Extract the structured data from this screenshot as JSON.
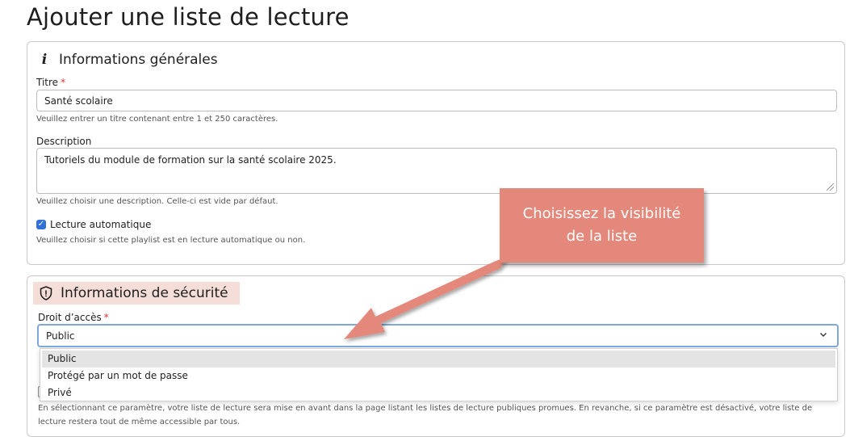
{
  "page": {
    "title": "Ajouter une liste de lecture"
  },
  "general": {
    "section_title": "Informations générales",
    "icon": "info-icon",
    "title_label": "Titre",
    "required_mark": "*",
    "title_value": "Santé scolaire",
    "title_help": "Veuillez entrer un titre contenant entre 1 et 250 caractères.",
    "description_label": "Description",
    "description_value": "Tutoriels du module de formation sur la santé scolaire 2025.",
    "description_help": "Veuillez choisir une description. Celle-ci est vide par défaut.",
    "autoplay_label": "Lecture automatique",
    "autoplay_checked": true,
    "autoplay_help": "Veuillez choisir si cette playlist est en lecture automatique ou non."
  },
  "security": {
    "section_title": "Informations de sécurité",
    "icon": "shield-icon",
    "access_label": "Droit d’accès",
    "required_mark": "*",
    "selected_value": "Public",
    "options": [
      "Public",
      "Protégé par un mot de passe",
      "Privé"
    ],
    "promoted_help_line1": "En sélectionnant ce paramètre, votre liste de lecture sera mise en avant dans la page listant les listes de lecture publiques promues. En revanche, si ce paramètre est désactivé, votre liste de",
    "promoted_help_line2": "lecture restera tout de même accessible par tous."
  },
  "callout": {
    "line1": "Choisissez la visibilité",
    "line2": "de la liste",
    "color": "#e3887a"
  },
  "colors": {
    "accent": "#2f6fda",
    "required": "#d9342b",
    "focus_border": "#7fa9dc",
    "highlight": "#f6ded8"
  }
}
